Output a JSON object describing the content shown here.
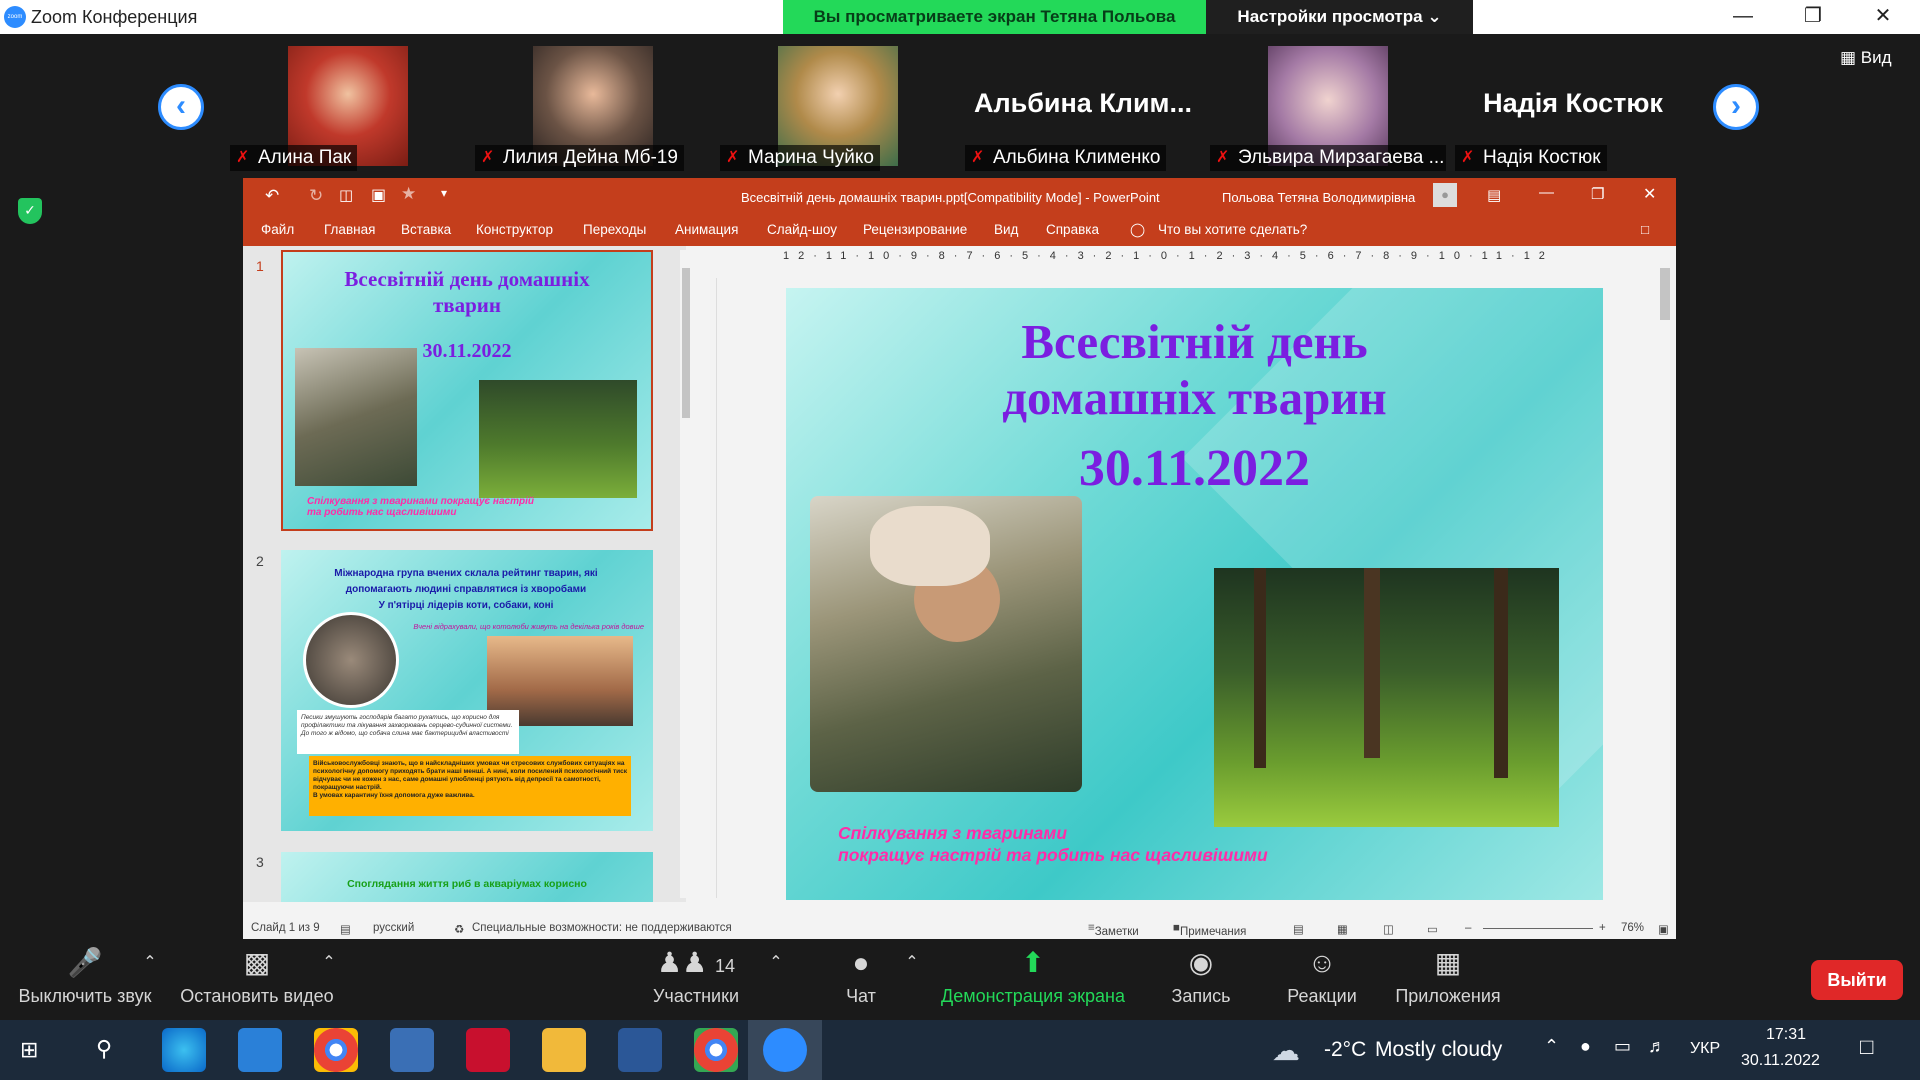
{
  "zoom": {
    "title": "Zoom Конференция",
    "share_banner": "Вы просматриваете экран Тетяна Польова",
    "view_options": "Настройки просмотра",
    "view_button": "Вид"
  },
  "participants": [
    {
      "name": "Алина Пак",
      "photo_color": "#c0392b"
    },
    {
      "name": "Лилия Дейна Мб-19",
      "photo_color": "#6b5345"
    },
    {
      "name": "Марина Чуйко",
      "photo_color": "#b08a4a"
    },
    {
      "name": "Альбина Клименко",
      "big_text": "Альбина  Клим..."
    },
    {
      "name": "Эльвира Мирзагаева ...",
      "photo_color": "#a47aa5"
    },
    {
      "name": "Надія Костюк",
      "big_text": "Надія Костюк"
    }
  ],
  "ppt": {
    "doc_title": "Всесвітній день домашніх тварин.ppt[Compatibility Mode]  -  PowerPoint",
    "user": "Польова Тетяна Володимирівна",
    "menu": [
      "Файл",
      "Главная",
      "Вставка",
      "Конструктор",
      "Переходы",
      "Анимация",
      "Слайд-шоу",
      "Рецензирование",
      "Вид",
      "Справка"
    ],
    "tell_me": "Что вы хотите сделать?",
    "ruler_top": "12·11·10·9·8·7·6·5·4·3·2·1·0·1·2·3·4·5·6·7·8·9·10·11·12",
    "thumbs": [
      {
        "num": "1",
        "title": "Всесвітній день домашніх тварин",
        "date": "30.11.2022",
        "caption": "Спілкування з тваринами покращує настрій та робить нас щасливішими"
      },
      {
        "num": "2",
        "title": "Міжнародна група вчених склала рейтинг тварин, які допомагають людині справлятися із хворобами",
        "sub": "У п'ятірці лідерів коти, собаки, коні",
        "note": "Вчені відрахували, що котолюби живуть на декілька років довше",
        "box1": "Песики змушують господарів багато рухатись, що корисно для профілактики та лікування захворювань серцево-судинної системи. До того ж відомо, що собача слина має бактерицидні властивості",
        "box2": "Військовослужбовці знають, що в найскладніших умовах чи стресових службових ситуаціях на психологічну допомогу приходять брати наші менші. А нині, коли посилений психологічний тиск відчуває чи не кожен з нас, саме домашні улюбленці рятують від депресії та самотності, покращуючи настрій.",
        "box3": "В умовах карантину їхня допомога дуже важлива."
      },
      {
        "num": "3",
        "title": "Споглядання життя риб в акваріумах корисно"
      }
    ],
    "slide": {
      "title_line1": "Всесвітній день",
      "title_line2": "домашніх тварин",
      "date": "30.11.2022",
      "caption_line1": "Спілкування з тваринами",
      "caption_line2": "покращує настрій та робить нас щасливішими"
    },
    "status": {
      "slide_info": "Слайд 1 из 9",
      "language": "русский",
      "accessibility": "Специальные возможности: не поддерживаются",
      "notes": "Заметки",
      "comments": "Примечания",
      "zoom": "76%"
    }
  },
  "toolbar": {
    "mute": "Выключить звук",
    "video": "Остановить видео",
    "participants": "Участники",
    "participants_count": "14",
    "chat": "Чат",
    "share": "Демонстрация экрана",
    "record": "Запись",
    "reactions": "Реакции",
    "apps": "Приложения",
    "leave": "Выйти"
  },
  "taskbar": {
    "weather_temp": "-2°C",
    "weather_text": "Mostly cloudy",
    "lang": "УКР",
    "time": "17:31",
    "date": "30.11.2022"
  }
}
